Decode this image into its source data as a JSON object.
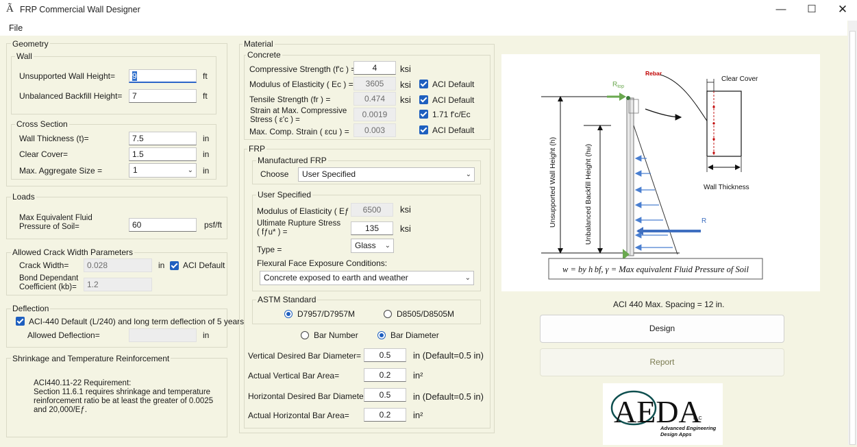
{
  "window": {
    "title": "FRP Commercial Wall Designer",
    "app_icon": "A-icon"
  },
  "menu": {
    "file": "File"
  },
  "geometry": {
    "legend": "Geometry",
    "wall": {
      "legend": "Wall",
      "unsupported_height_label": "Unsupported Wall Height=",
      "unsupported_height_value": "9",
      "unsupported_height_unit": "ft",
      "backfill_height_label": "Unbalanced Backfill Height=",
      "backfill_height_value": "7",
      "backfill_height_unit": "ft"
    },
    "cross_section": {
      "legend": "Cross Section",
      "thickness_label": "Wall Thickness (t)=",
      "thickness_value": "7.5",
      "thickness_unit": "in",
      "cover_label": "Clear Cover=",
      "cover_value": "1.5",
      "cover_unit": "in",
      "aggregate_label": "Max. Aggregate Size =",
      "aggregate_value": "1",
      "aggregate_unit": "in"
    }
  },
  "loads": {
    "legend": "Loads",
    "fluid_label_1": "Max Equivalent Fluid",
    "fluid_label_2": "Pressure of Soil=",
    "fluid_value": "60",
    "fluid_unit": "psf/ft"
  },
  "crack": {
    "legend": "Allowed Crack Width Parameters",
    "width_label": "Crack Width=",
    "width_value": "0.028",
    "width_unit": "in",
    "aci_default": "ACI Default",
    "bond_label_1": "Bond Dependant",
    "bond_label_2": "Coefficient (kb)=",
    "bond_value": "1.2"
  },
  "deflection": {
    "legend": "Deflection",
    "checkbox_label": "ACI-440 Default (L/240) and long term deflection of 5 years",
    "allowed_label": "Allowed Deflection=",
    "allowed_value": "",
    "allowed_unit": "in"
  },
  "shrinkage": {
    "legend": "Shrinkage and Temperature Reinforcement",
    "line1": "ACI440.11-22 Requirement:",
    "line2": "Section 11.6.1 requires shrinkage and temperature",
    "line3": "reinforcement ratio be at least the greater of 0.0025",
    "line4": "and 20,000/Eƒ."
  },
  "material": {
    "legend": "Material",
    "concrete": {
      "legend": "Concrete",
      "fc_label": "Compressive Strength (f'c ) =",
      "fc_value": "4",
      "fc_unit": "ksi",
      "ec_label": "Modulus of Elasticity ( Ec ) =",
      "ec_value": "3605",
      "ec_unit": "ksi",
      "ec_default": "ACI Default",
      "fr_label": "Tensile Strength (fr ) =",
      "fr_value": "0.474",
      "fr_unit": "ksi",
      "fr_default": "ACI Default",
      "strain_label_1": "Strain at Max. Compressive",
      "strain_label_2": "Stress ( ε'c ) =",
      "strain_value": "0.0019",
      "strain_default": "1.71 f'c/Ec",
      "ecu_label": "Max. Comp. Strain ( εcu ) =",
      "ecu_value": "0.003",
      "ecu_default": "ACI Default"
    },
    "frp": {
      "legend": "FRP",
      "manufactured": {
        "legend": "Manufactured FRP",
        "choose_label": "Choose",
        "choose_value": "User Specified"
      },
      "user": {
        "legend": "User Specified",
        "ef_label": "Modulus of Elasticity ( Eƒ ) =",
        "ef_value": "6500",
        "ef_unit": "ksi",
        "ffu_label_1": "Ultimate Rupture Stress",
        "ffu_label_2": "( fƒu* ) =",
        "ffu_value": "135",
        "ffu_unit": "ksi",
        "type_label": "Type =",
        "type_value": "Glass",
        "exposure_label": "Flexural Face Exposure Conditions:",
        "exposure_value": "Concrete exposed to earth and weather"
      },
      "astm": {
        "legend": "ASTM Standard",
        "opt1": "D7957/D7957M",
        "opt2": "D8505/D8505M"
      },
      "bar_number": "Bar Number",
      "bar_diameter": "Bar Diameter",
      "v_dia_label": "Vertical Desired Bar Diameter=",
      "v_dia_value": "0.5",
      "v_dia_unit": "in  (Default=0.5 in)",
      "v_area_label": "Actual Vertical Bar Area=",
      "v_area_value": "0.2",
      "v_area_unit": "in²",
      "h_dia_label": "Horizontal Desired Bar Diameter=",
      "h_dia_value": "0.5",
      "h_dia_unit": "in  (Default=0.5 in)",
      "h_area_label": "Actual Horizontal Bar Area=",
      "h_area_value": "0.2",
      "h_area_unit": "in²"
    }
  },
  "diagram": {
    "rebar": "Rebar",
    "clear_cover": "Clear Cover",
    "wall_thickness": "Wall Thickness",
    "rtop": "R",
    "rtop_sub": "top",
    "r": "R",
    "unsupported": "Unsupported Wall Height (h)",
    "backfill": "Unbalanced Backfill Height (h",
    "backfill_sub": "bf",
    "formula": "w = by h bf, γ = Max equivalent Fluid Pressure of Soil"
  },
  "spacing_note": "ACI 440 Max. Spacing = 12 in.",
  "buttons": {
    "design": "Design",
    "report": "Report"
  },
  "logo": {
    "letters": "AEDA",
    "llc": "LLC",
    "tag1": "Advanced Engineering",
    "tag2": "Design Apps"
  }
}
